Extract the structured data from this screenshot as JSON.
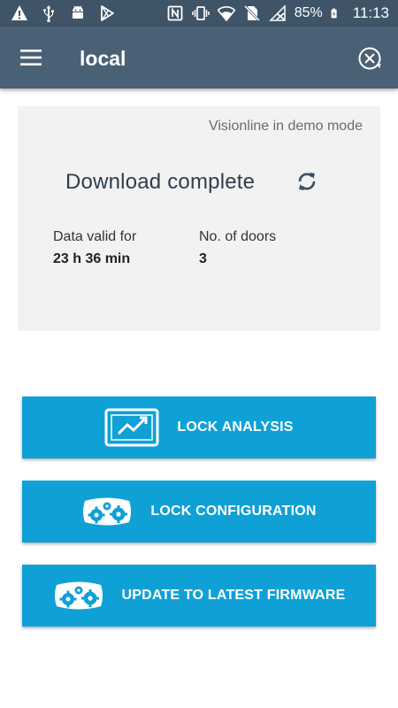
{
  "status_bar": {
    "battery": "85%",
    "time": "11:13",
    "left_icons": [
      "warning-icon",
      "usb-icon",
      "android-icon",
      "play-store-icon"
    ],
    "right_icons": [
      "nfc-icon",
      "vibrate-icon",
      "wifi-icon",
      "no-sim-icon",
      "signal-off-icon",
      "battery-icon"
    ]
  },
  "app_bar": {
    "title": "local",
    "menu_icon": "hamburger-menu-icon",
    "action_icon": "close-circle-icon"
  },
  "status_card": {
    "mode_text": "Visionline in demo mode",
    "status_text": "Download complete",
    "refresh_icon": "refresh-icon",
    "valid_label": "Data valid for",
    "valid_value": "23 h 36 min",
    "doors_label": "No. of doors",
    "doors_value": "3"
  },
  "actions": [
    {
      "label": "LOCK ANALYSIS",
      "icon": "analysis-chart-icon"
    },
    {
      "label": "LOCK CONFIGURATION",
      "icon": "gears-icon"
    },
    {
      "label": "UPDATE TO LATEST FIRMWARE",
      "icon": "gears-icon"
    }
  ],
  "colors": {
    "status_bar": "#3f5467",
    "app_bar": "#4a6075",
    "card_bg": "#f2f2f2",
    "button": "#0fa1d6",
    "title_text": "#2e3e4e"
  }
}
